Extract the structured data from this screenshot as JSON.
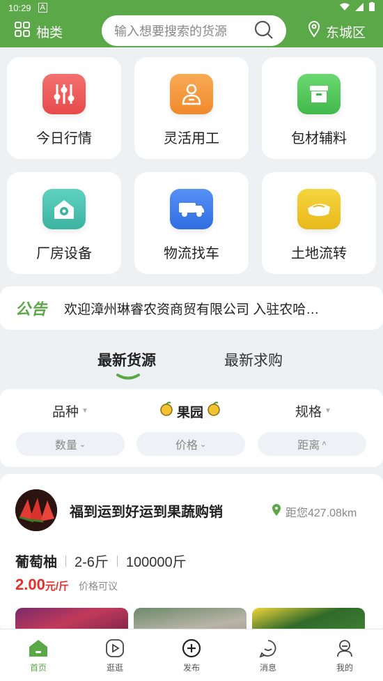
{
  "status_bar": {
    "time": "10:29"
  },
  "header": {
    "category_label": "柚类",
    "search_placeholder": "输入想要搜索的货源",
    "location_label": "东城区"
  },
  "menu": [
    {
      "label": "今日行情",
      "icon": "sliders-icon",
      "color": "#ef5a5a"
    },
    {
      "label": "灵活用工",
      "icon": "worker-icon",
      "color": "#f59a3c"
    },
    {
      "label": "包材辅料",
      "icon": "box-icon",
      "color": "#4ec65a"
    },
    {
      "label": "厂房设备",
      "icon": "factory-gear-icon",
      "color": "#48c2b0"
    },
    {
      "label": "物流找车",
      "icon": "truck-icon",
      "color": "#3f7ff0"
    },
    {
      "label": "土地流转",
      "icon": "land-icon",
      "color": "#f0c928"
    }
  ],
  "notice": {
    "tag": "公告",
    "text": "欢迎漳州琳睿农资商贸有限公司 入驻农哈…"
  },
  "tabs": [
    {
      "label": "最新货源",
      "active": true
    },
    {
      "label": "最新求购",
      "active": false
    }
  ],
  "filters": {
    "row1": [
      "品种",
      "果园",
      "规格"
    ],
    "row2": [
      "数量",
      "价格",
      "距离"
    ]
  },
  "listing": {
    "shop_name": "福到运到好运到果蔬购销",
    "distance": "距您427.08km",
    "product_name": "葡萄柚",
    "spec": "2-6斤",
    "quantity": "100000斤",
    "price": "2.00",
    "price_unit": "元/斤",
    "negotiable": "价格可议"
  },
  "bottom_nav": [
    {
      "label": "首页",
      "icon": "home-icon",
      "active": true
    },
    {
      "label": "逛逛",
      "icon": "play-icon",
      "active": false
    },
    {
      "label": "发布",
      "icon": "plus-circle-icon",
      "active": false
    },
    {
      "label": "消息",
      "icon": "message-icon",
      "active": false
    },
    {
      "label": "我的",
      "icon": "profile-icon",
      "active": false
    }
  ],
  "colors": {
    "brand": "#5aa847",
    "price": "#e0312b"
  }
}
